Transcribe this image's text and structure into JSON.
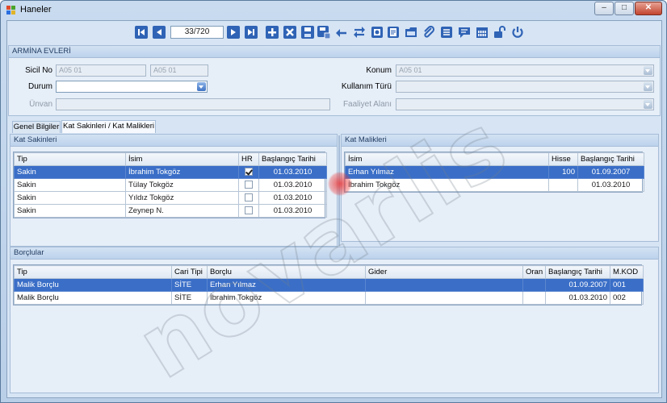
{
  "window": {
    "title": "Haneler",
    "min": "–",
    "max": "□",
    "close": "✕"
  },
  "toolbar": {
    "record_counter": "33/720",
    "buttons": [
      "first-icon",
      "prev-icon",
      "next-icon",
      "last-icon",
      "add-icon",
      "delete-icon",
      "save-icon",
      "save-as-icon",
      "undo-icon",
      "refresh-icon",
      "report-icon",
      "preview-icon",
      "folder-icon",
      "attach-icon",
      "list-icon",
      "message-icon",
      "calendar-icon",
      "unlock-icon",
      "power-icon"
    ]
  },
  "header_panel": {
    "title": "ARMİNA EVLERİ",
    "sicil_no": {
      "label": "Sicil No",
      "value1": "A05 01",
      "value2": "A05 01"
    },
    "durum": {
      "label": "Durum",
      "value": ""
    },
    "unvan": {
      "label": "Ünvan",
      "value": ""
    },
    "konum": {
      "label": "Konum",
      "value": "A05 01"
    },
    "kullanim_turu": {
      "label": "Kullanım Türü",
      "value": ""
    },
    "faaliyet_alani": {
      "label": "Faaliyet Alanı",
      "value": ""
    }
  },
  "tabs": [
    {
      "label": "Genel Bilgiler"
    },
    {
      "label": "Kat Sakinleri / Kat Malikleri"
    }
  ],
  "kat_sakinleri": {
    "title": "Kat Sakinleri",
    "columns": [
      "Tip",
      "İsim",
      "HR",
      "Başlangıç Tarihi"
    ],
    "rows": [
      {
        "tip": "Sakin",
        "isim": "İbrahim Tokgöz",
        "hr": true,
        "tarih": "01.03.2010"
      },
      {
        "tip": "Sakin",
        "isim": "Tülay Tokgöz",
        "hr": false,
        "tarih": "01.03.2010"
      },
      {
        "tip": "Sakin",
        "isim": "Yıldız Tokgöz",
        "hr": false,
        "tarih": "01.03.2010"
      },
      {
        "tip": "Sakin",
        "isim": "Zeynep N.",
        "hr": false,
        "tarih": "01.03.2010"
      }
    ]
  },
  "kat_malikleri": {
    "title": "Kat Malikleri",
    "columns": [
      "İsim",
      "Hisse",
      "Başlangıç Tarihi"
    ],
    "rows": [
      {
        "isim": "Erhan Yılmaz",
        "hisse": "100",
        "tarih": "01.09.2007"
      },
      {
        "isim": "İbrahim Tokgöz",
        "hisse": "",
        "tarih": "01.03.2010"
      }
    ]
  },
  "borclular": {
    "title": "Borçlular",
    "columns": [
      "Tip",
      "Cari Tipi",
      "Borçlu",
      "Gider",
      "Oran",
      "Başlangıç Tarihi",
      "M.KOD"
    ],
    "rows": [
      {
        "tip": "Malik Borçlu",
        "cari": "SİTE",
        "borclu": "Erhan Yılmaz",
        "gider": "",
        "oran": "",
        "tarih": "01.09.2007",
        "kod": "001"
      },
      {
        "tip": "Malik Borçlu",
        "cari": "SİTE",
        "borclu": "İbrahim Tokgöz",
        "gider": "",
        "oran": "",
        "tarih": "01.03.2010",
        "kod": "002"
      }
    ]
  },
  "watermark": "novarlis",
  "colors": {
    "selection": "#3a6ec7",
    "panel": "#e6eef8",
    "header": "#bcd2ec"
  }
}
